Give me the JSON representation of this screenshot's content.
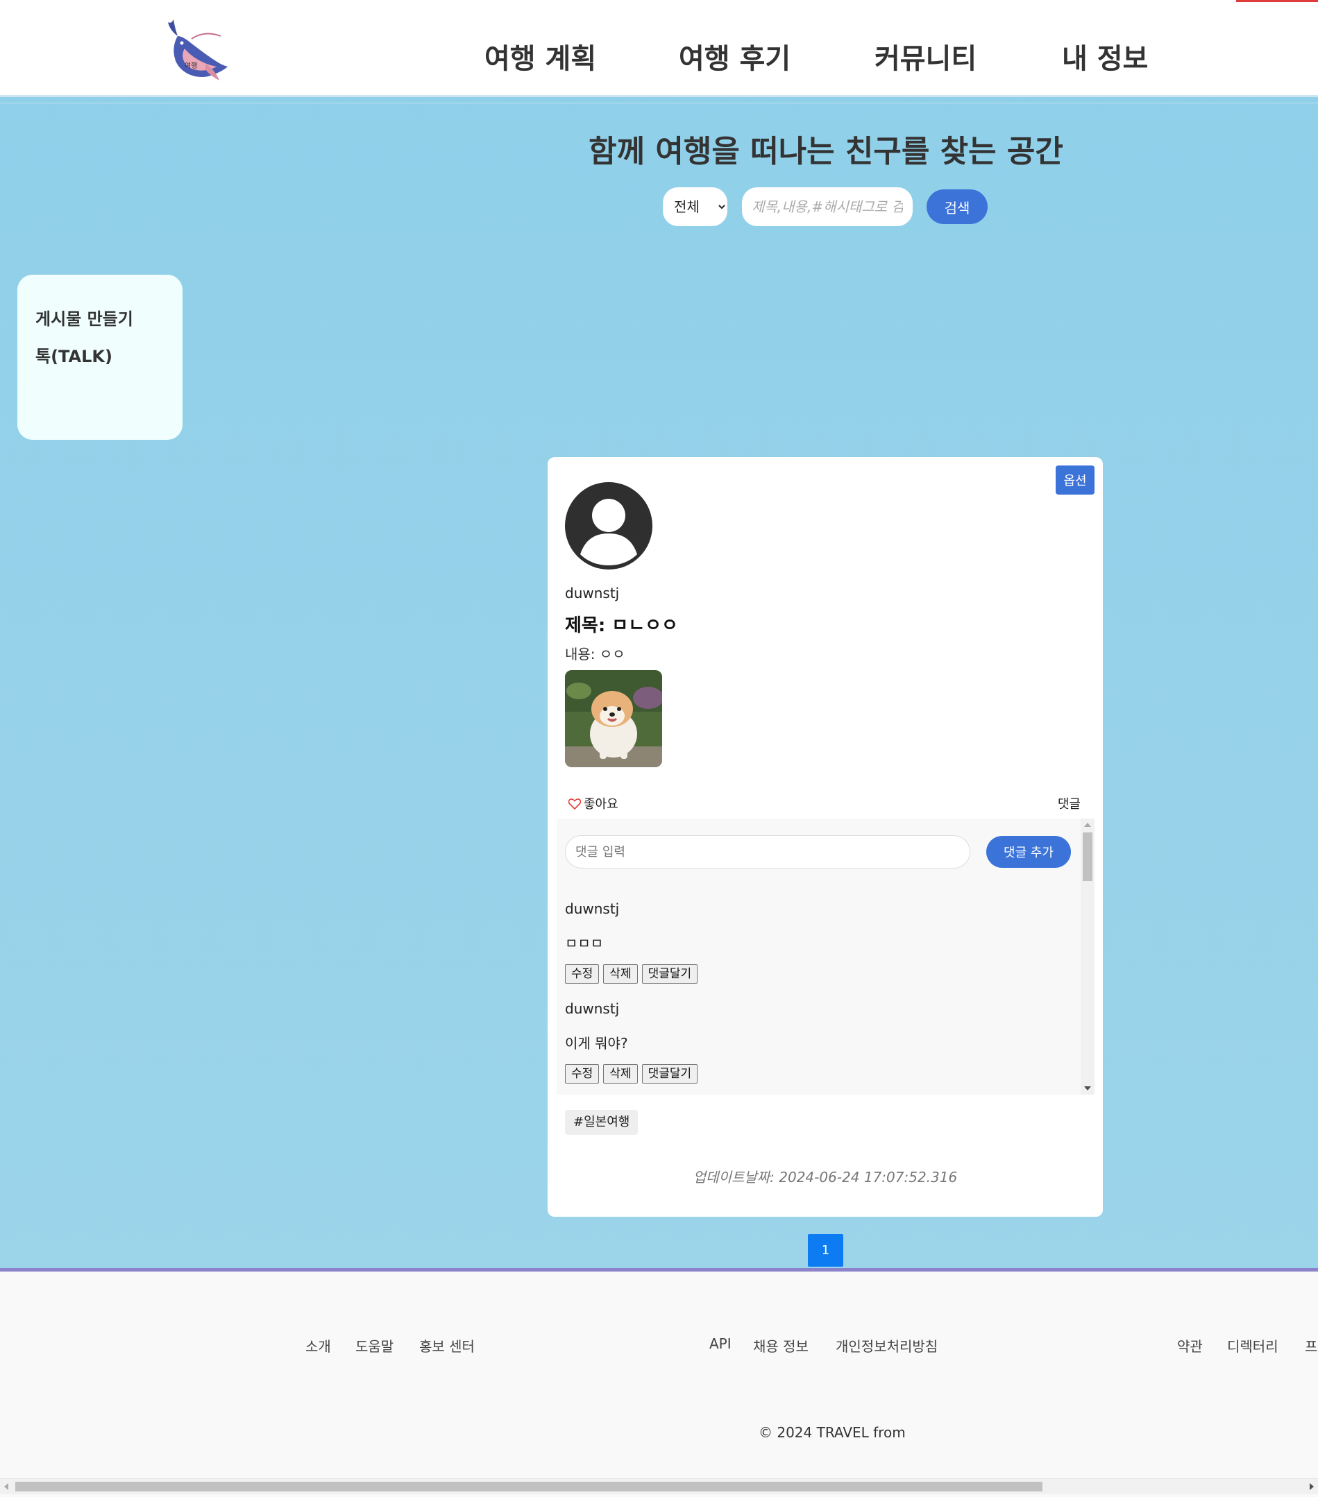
{
  "colors": {
    "accent": "#3b73d9",
    "page_bg": "#9ad3ea",
    "page_button": "#0d7cf2",
    "footer_border": "#8a83c9",
    "heart": "#e53935",
    "top_accent": "#e03b3b"
  },
  "header": {
    "logo_icon": "whale-logo",
    "nav": [
      "여행 계획",
      "여행 후기",
      "커뮤니티",
      "내 정보"
    ]
  },
  "hero": {
    "title": "함께 여행을 떠나는 친구를 찾는 공간",
    "search": {
      "filter_selected": "전체",
      "placeholder": "제목,내용,#해시태그로 검색",
      "button_label": "검색"
    }
  },
  "sidebar": {
    "items": [
      "게시물 만들기",
      "톡(TALK)"
    ]
  },
  "post": {
    "option_label": "옵션",
    "avatar_icon": "user-avatar-icon",
    "author": "duwnstj",
    "title": "제목: ㅁㄴㅇㅇ",
    "content": "내용: ㅇㅇ",
    "image_icon": "pomeranian-photo",
    "like_label": "좋아요",
    "comment_label": "댓글",
    "comment_input_placeholder": "댓글 입력",
    "comment_add_label": "댓글 추가",
    "comments": [
      {
        "author": "duwnstj",
        "text": "ㅁㅁㅁ",
        "edit": "수정",
        "delete": "삭제",
        "reply": "댓글달기"
      },
      {
        "author": "duwnstj",
        "text": "이게 뭐야?",
        "edit": "수정",
        "delete": "삭제",
        "reply": "댓글달기"
      }
    ],
    "hashtag": "#일본여행",
    "updated": "업데이트날짜: 2024-06-24 17:07:52.316"
  },
  "pagination": {
    "current": "1"
  },
  "footer": {
    "links": [
      "소개",
      "도움말",
      "홍보 센터",
      "API",
      "채용 정보",
      "개인정보처리방침",
      "약관",
      "디렉터리",
      "프"
    ],
    "copyright": "© 2024 TRAVEL from"
  }
}
